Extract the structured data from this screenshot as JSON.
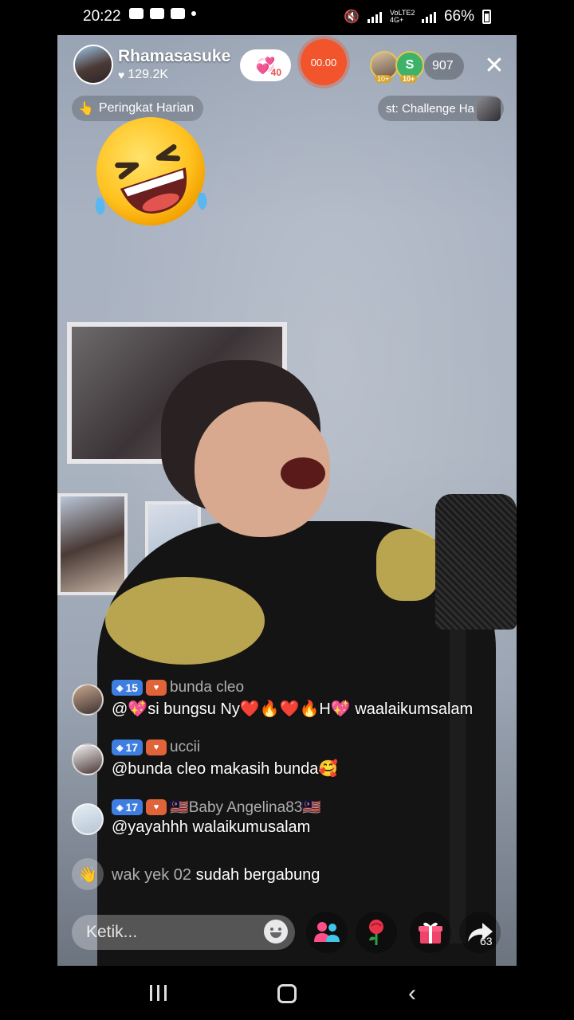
{
  "status_bar": {
    "time": "20:22",
    "network": "VoLTE2 4G+",
    "battery": "66%"
  },
  "stream": {
    "host_name": "Rhamasasuke",
    "host_likes": "129.2K",
    "gift_count": "40",
    "timer": "00.00",
    "viewer_badge_1": "10+",
    "viewer_badge_2": "10+",
    "viewer_letter": "S",
    "viewer_count": "907",
    "ranking_label": "Peringkat Harian",
    "challenge_label": "st: Challenge Ha"
  },
  "chat": {
    "messages": [
      {
        "level": "15",
        "user": "bunda cleo",
        "text": "@💖si bungsu Ny❤️🔥❤️🔥H💖 waalaikumsalam"
      },
      {
        "level": "17",
        "user": "uccii",
        "text": "@bunda cleo makasih bunda🥰"
      },
      {
        "level": "17",
        "user": "🇲🇾Baby Angelina83🇲🇾",
        "text": "@yayahhh walaikumusalam"
      }
    ],
    "join": {
      "user": "wak yek 02",
      "text": "sudah bergabung"
    }
  },
  "bottom_bar": {
    "input_placeholder": "Ketik...",
    "share_count": "63"
  },
  "colors": {
    "timer": "#f2542b",
    "level_badge": "#3e7ee0",
    "fan_badge": "#e0633a",
    "viewer_green": "#3db36a"
  }
}
